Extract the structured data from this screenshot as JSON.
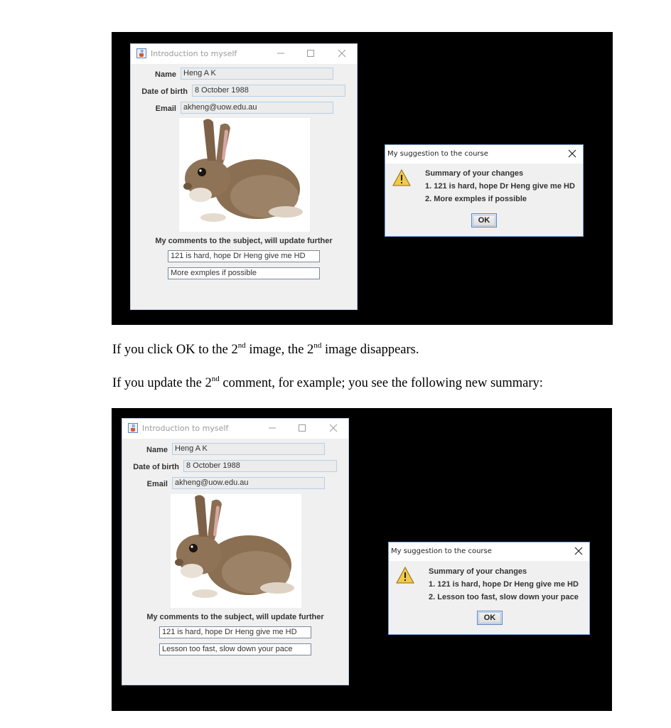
{
  "screenshot1": {
    "main_window": {
      "title": "Introduction to myself",
      "name_label": "Name",
      "name_value": "Heng A K",
      "dob_label": "Date of birth",
      "dob_value": "8 October 1988",
      "email_label": "Email",
      "email_value": "akheng@uow.edu.au",
      "comments_label": "My comments to the subject, will update further",
      "comment1": "121 is hard, hope Dr Heng give me HD",
      "comment2": "More exmples if possible"
    },
    "dialog": {
      "title": "My suggestion to the course",
      "line1": "Summary of your changes",
      "line2": "1. 121 is hard, hope Dr Heng give me HD",
      "line3": "2. More exmples if possible",
      "ok_label": "OK"
    }
  },
  "text": {
    "p1_a": "If you click OK to the 2",
    "p1_sup1": "nd",
    "p1_b": " image, the 2",
    "p1_sup2": "nd",
    "p1_c": " image disappears.",
    "p2_a": "If you update the 2",
    "p2_sup": "nd",
    "p2_b": " comment, for example; you see the following new summary:"
  },
  "screenshot2": {
    "main_window": {
      "title": "Introduction to myself",
      "name_label": "Name",
      "name_value": "Heng A K",
      "dob_label": "Date of birth",
      "dob_value": "8 October 1988",
      "email_label": "Email",
      "email_value": "akheng@uow.edu.au",
      "comments_label": "My comments to the subject, will update further",
      "comment1": "121 is hard, hope Dr Heng give me HD",
      "comment2": "Lesson too fast, slow down your pace"
    },
    "dialog": {
      "title": "My suggestion to the course",
      "line1": "Summary of your changes",
      "line2": "1. 121 is hard, hope Dr Heng give me HD",
      "line3": "2. Lesson too fast, slow down your pace",
      "ok_label": "OK"
    }
  },
  "icons": {
    "window_icon": "java-cup-icon",
    "warning": "warning-triangle-icon",
    "close": "close-icon"
  }
}
